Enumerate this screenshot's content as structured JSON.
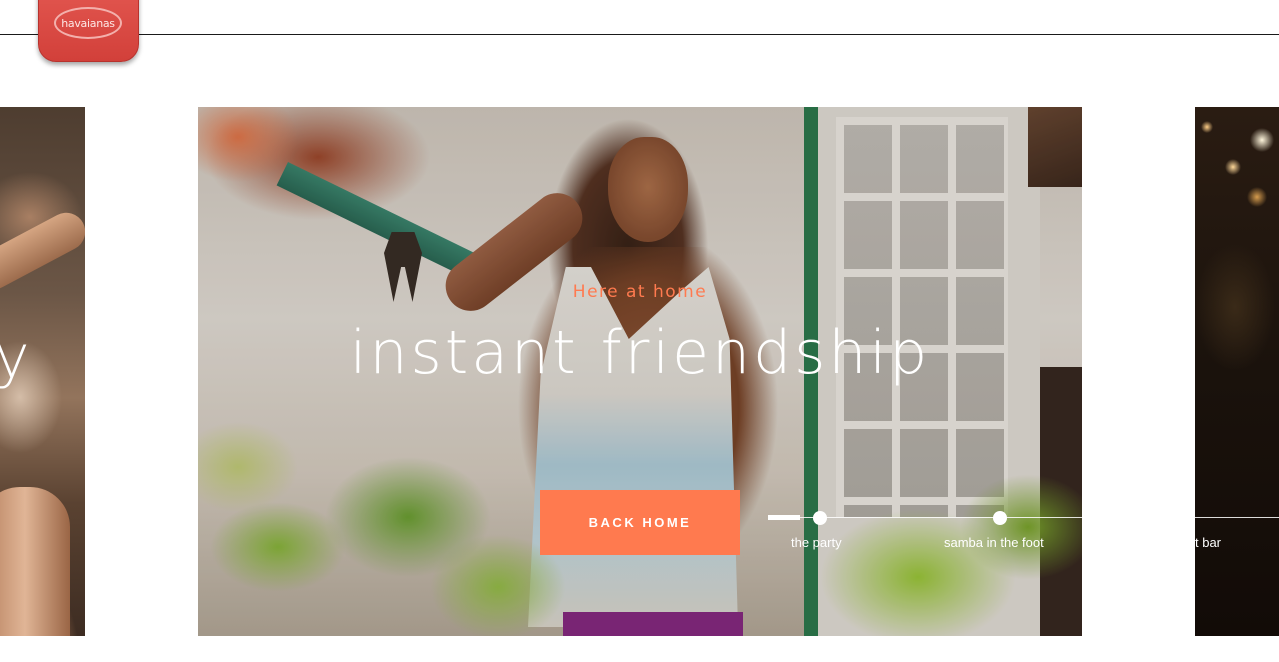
{
  "header": {
    "logo_text": "havaianas"
  },
  "slides": {
    "previous": {
      "title_fragment": "y"
    },
    "current": {
      "eyebrow": "Here at home",
      "title": "instant friendship",
      "cta_label": "BACK HOME"
    }
  },
  "timeline": {
    "items": [
      {
        "label": "the party"
      },
      {
        "label": "samba in the foot"
      },
      {
        "label": "t bar"
      }
    ]
  },
  "colors": {
    "accent": "#ff7a4f",
    "brand_red": "#d2403a",
    "rule": "#1a1a1a"
  }
}
